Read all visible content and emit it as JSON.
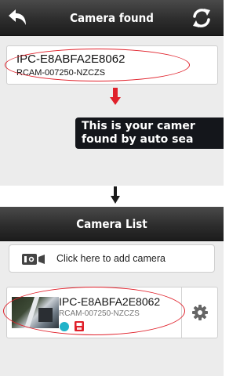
{
  "top_screen": {
    "title": "Camera found",
    "icons": {
      "back": "back-arrow-icon",
      "refresh": "refresh-icon"
    },
    "found_camera": {
      "name": "IPC-E8ABFA2E8062",
      "id": "RCAM-007250-NZCZS"
    },
    "callout": {
      "line1": "This is your camer",
      "line2": "found by auto sea"
    }
  },
  "bottom_screen": {
    "title": "Camera List",
    "add_camera": {
      "label": "Click here to add camera",
      "icon": "add-camera-icon"
    },
    "camera": {
      "name": "IPC-E8ABFA2E8062",
      "id": "RCAM-007250-NZCZS",
      "status_icons": [
        "online-status-icon",
        "record-icon"
      ],
      "settings_icon": "gear-icon"
    }
  },
  "colors": {
    "highlight": "#e0202a",
    "titlebar": "#2d2d2d",
    "callout_bg": "#14161b",
    "online": "#20b3c9",
    "record": "#e0202a"
  }
}
